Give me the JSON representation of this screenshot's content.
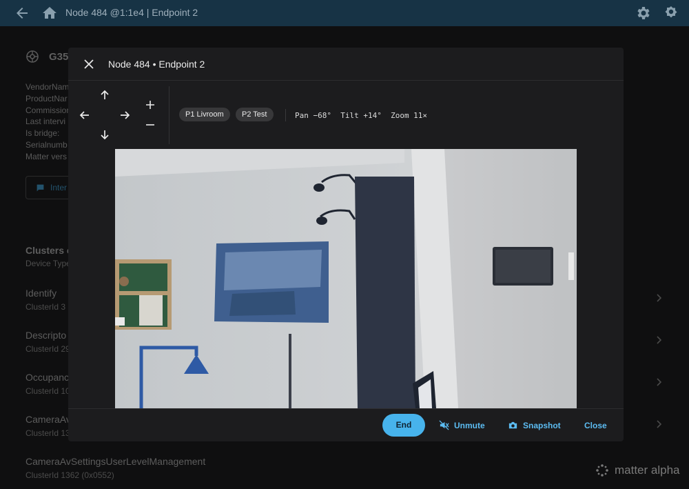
{
  "topbar": {
    "title": "Node 484 @1:1e4 | Endpoint 2",
    "icons": [
      "arrow-left-icon",
      "home-icon",
      "gear-icon",
      "gear-badge-icon"
    ]
  },
  "device": {
    "title": "G35",
    "info_lines": [
      "VendorNam",
      "ProductNar",
      "Commission",
      "Last intervi",
      "Is bridge:",
      "Serialnumb",
      "Matter vers"
    ],
    "interview_label": "Inter"
  },
  "clusters": {
    "heading": "Clusters c",
    "subheading": "Device Type",
    "items": [
      {
        "name": "Identify",
        "id": "ClusterId 3"
      },
      {
        "name": "Descripto",
        "id": "ClusterId 29"
      },
      {
        "name": "Occupanc",
        "id": "ClusterId 10"
      },
      {
        "name": "CameraAv",
        "id": "ClusterId 13"
      },
      {
        "name": "CameraAvSettingsUserLevelManagement",
        "id": "ClusterId 1362 (0x0552)"
      }
    ]
  },
  "brand": {
    "text": "matter alpha"
  },
  "modal": {
    "title": "Node 484 • Endpoint 2",
    "presets": [
      "P1 Livroom",
      "P2 Test"
    ],
    "readout": "Pan −68°  Tilt +14°  Zoom 11×",
    "footer": {
      "end_label": "End",
      "unmute_label": "Unmute",
      "snapshot_label": "Snapshot",
      "close_label": "Close"
    }
  },
  "colors": {
    "topbar": "#173345",
    "accent": "#47b3ec",
    "modal_bg": "#1c1c1e",
    "chip_bg": "#38383a"
  }
}
